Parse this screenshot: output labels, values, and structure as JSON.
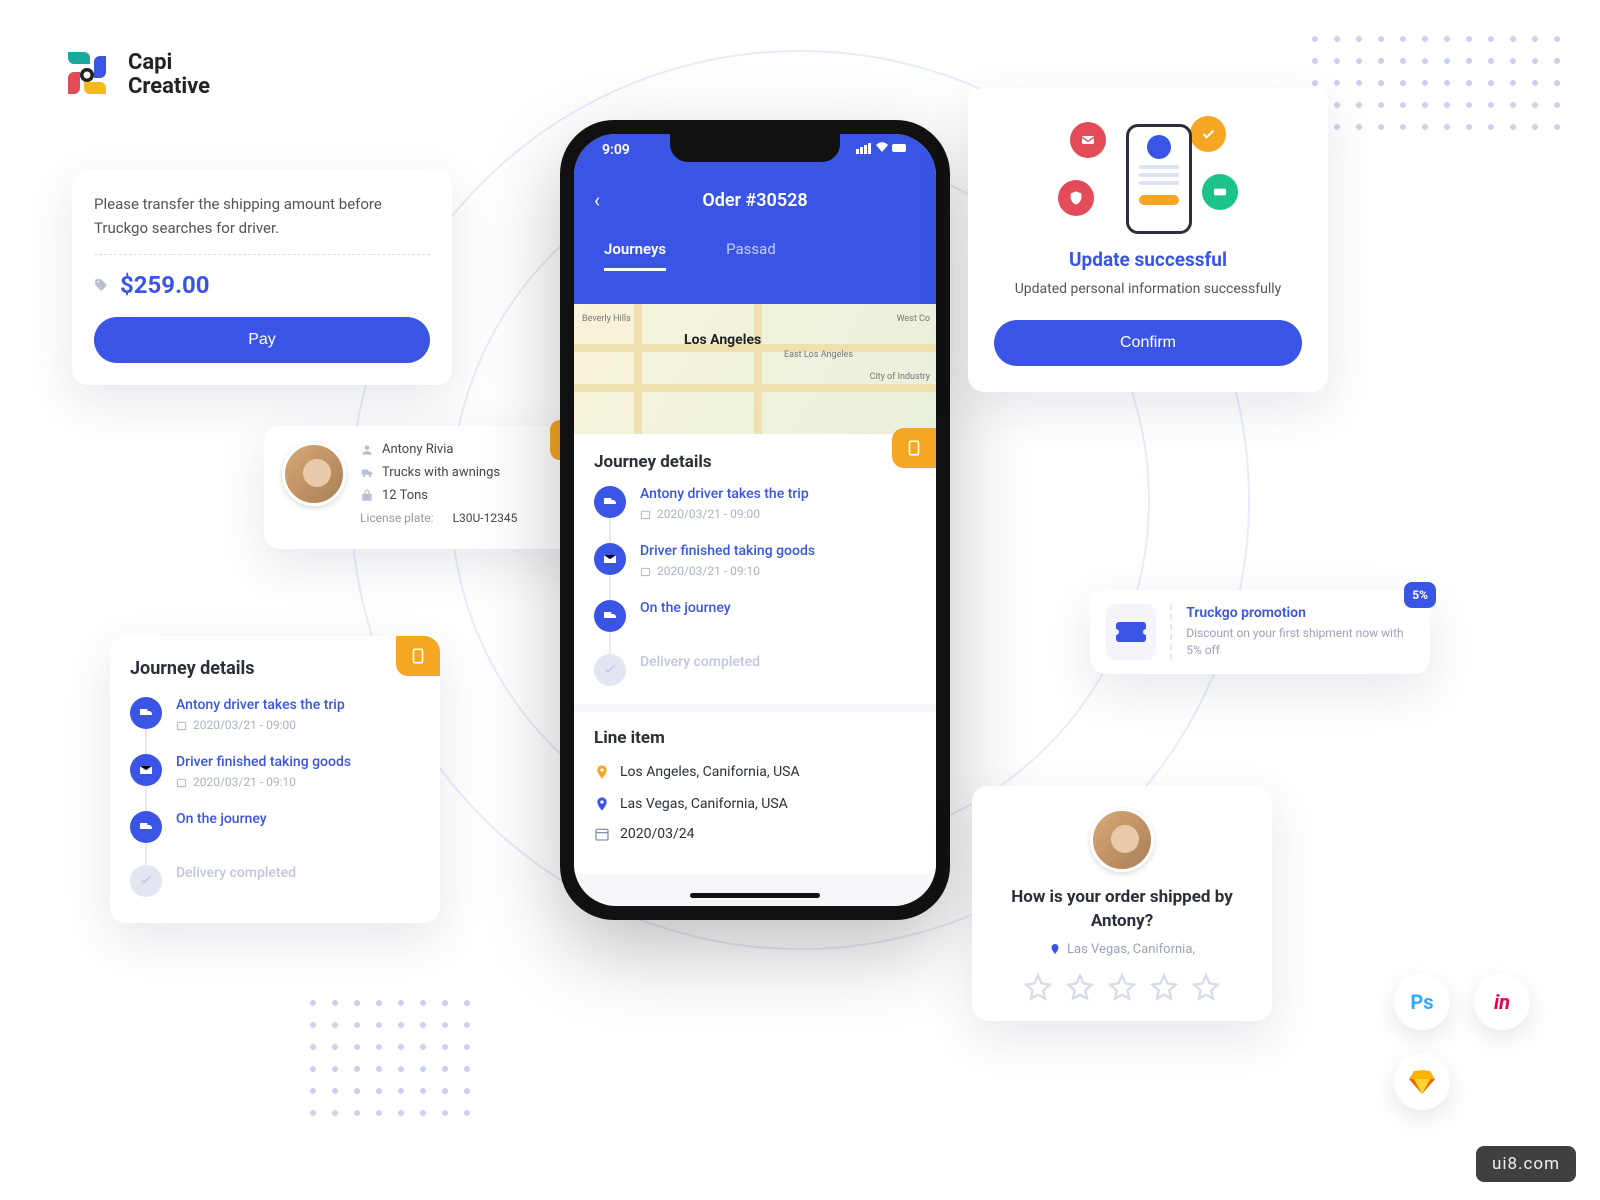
{
  "brand": {
    "line1": "Capi",
    "line2": "Creative"
  },
  "pay": {
    "message": "Please transfer the shipping amount before Truckgo searches for driver.",
    "amount": "$259.00",
    "button": "Pay"
  },
  "driver": {
    "name": "Antony Rivia",
    "vehicle": "Trucks with awnings",
    "weight": "12 Tons",
    "plate_label": "License plate:",
    "plate_value": "L30U-12345"
  },
  "journey": {
    "title": "Journey details",
    "steps": [
      {
        "title": "Antony driver takes the trip",
        "time": "2020/03/21 - 09:00",
        "active": true
      },
      {
        "title": "Driver finished taking goods",
        "time": "2020/03/21 - 09:10",
        "active": true
      },
      {
        "title": "On the journey",
        "time": "",
        "active": true
      },
      {
        "title": "Delivery completed",
        "time": "",
        "active": false
      }
    ]
  },
  "phone": {
    "time": "9:09",
    "back": "‹",
    "title": "Oder #30528",
    "tabs": {
      "journeys": "Journeys",
      "passed": "Passad"
    },
    "map_city": "Los Angeles",
    "map_labels": [
      "Beverly Hills",
      "East Los Angeles",
      "West Co",
      "City of Industry"
    ],
    "line_item": {
      "title": "Line item",
      "origin": "Los Angeles, Canifornia, USA",
      "dest": "Las Vegas, Canifornia, USA",
      "date": "2020/03/24"
    }
  },
  "success": {
    "title": "Update successful",
    "subtitle": "Updated personal information successfully",
    "button": "Confirm"
  },
  "promo": {
    "title": "Truckgo promotion",
    "subtitle": "Discount on your first shipment now with 5% off",
    "badge": "5%"
  },
  "rating": {
    "title": "How is your order shipped by Antony?",
    "location": "Las Vegas, Canifornia,"
  },
  "tools": {
    "ps": "Ps",
    "in": "in"
  },
  "watermark": "ui8.com"
}
